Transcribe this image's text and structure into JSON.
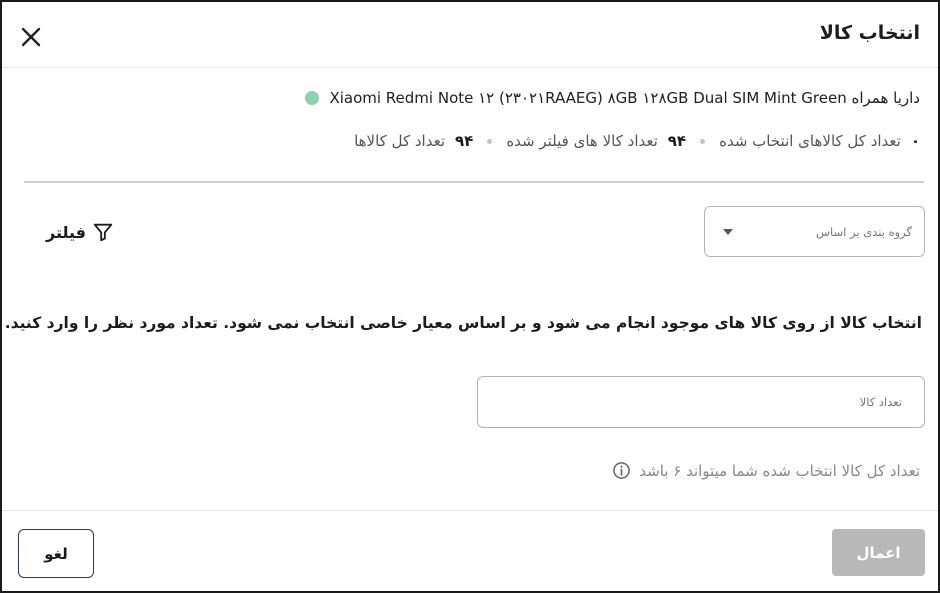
{
  "dialog": {
    "title": "انتخاب کالا",
    "close_icon": "close-icon"
  },
  "product": {
    "name": "داریا همراه Xiaomi Redmi Note ۱۲ (۲۳۰۲۱RAAEG) ۸GB ۱۲۸GB Dual SIM Mint Green",
    "status_color": "#8fcfb1"
  },
  "stats": {
    "total_label": "تعداد کل کالاها",
    "total_value": "۹۴",
    "filtered_label": "تعداد کالا های فیلتر شده",
    "filtered_value": "۹۴",
    "selected_label": "تعداد کل کالاهای انتخاب شده",
    "selected_value": "۰"
  },
  "grouping": {
    "placeholder": "گروه بندی بر اساس"
  },
  "filter": {
    "label": "فیلتر",
    "icon": "filter-icon"
  },
  "instruction": "انتخاب کالا از روی کالا های موجود انجام می شود و بر اساس معیار خاصی انتخاب نمی شود. تعداد مورد نظر را وارد کنید.",
  "quantity": {
    "placeholder": "تعداد کالا",
    "value": ""
  },
  "hint": {
    "text": "تعداد کل کالا انتخاب شده شما میتواند ۶ باشد",
    "icon": "info-icon"
  },
  "footer": {
    "cancel_label": "لغو",
    "apply_label": "اعمال"
  },
  "colors": {
    "apply_disabled": "#b8b8b8",
    "cancel_border": "#2b3a55"
  }
}
